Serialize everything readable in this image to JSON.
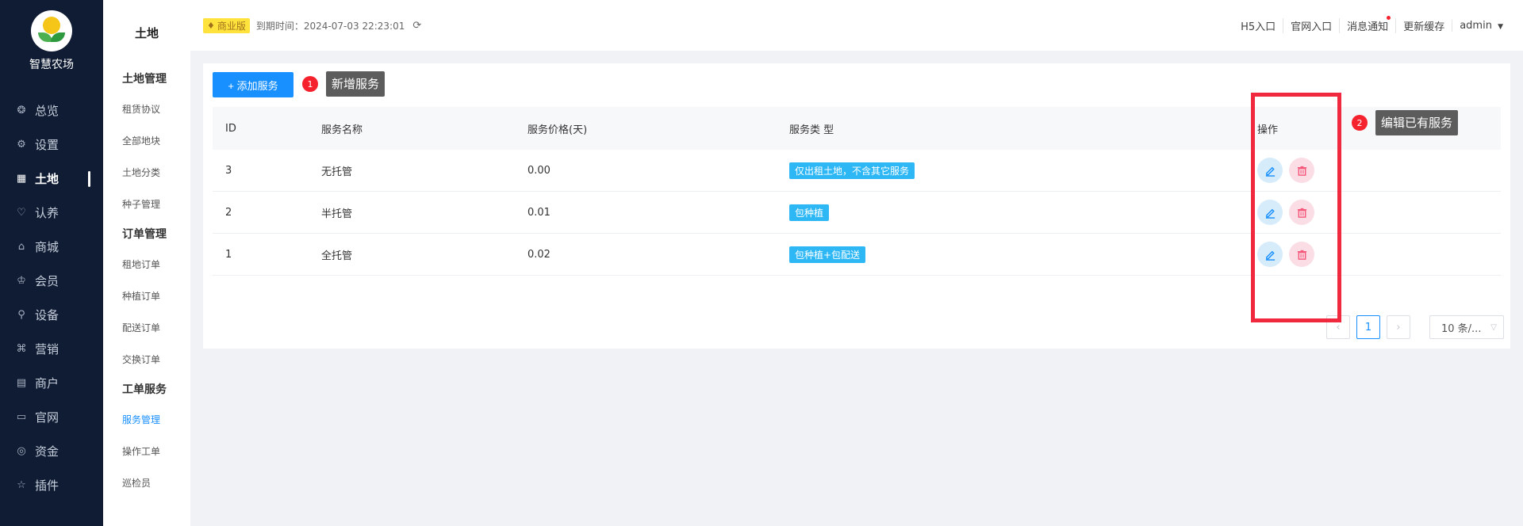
{
  "app": {
    "logo_text": "智慧农场"
  },
  "sidebar": {
    "items": [
      {
        "label": "总览",
        "icon": "dashboard-icon",
        "glyph": "❂"
      },
      {
        "label": "设置",
        "icon": "gear-icon",
        "glyph": "⚙"
      },
      {
        "label": "土地",
        "icon": "grid-icon",
        "glyph": "▦",
        "active": true
      },
      {
        "label": "认养",
        "icon": "heart-icon",
        "glyph": "♡"
      },
      {
        "label": "商城",
        "icon": "store-icon",
        "glyph": "⌂"
      },
      {
        "label": "会员",
        "icon": "crown-icon",
        "glyph": "♔"
      },
      {
        "label": "设备",
        "icon": "bulb-icon",
        "glyph": "⚲"
      },
      {
        "label": "营销",
        "icon": "command-icon",
        "glyph": "⌘"
      },
      {
        "label": "商户",
        "icon": "shop-icon",
        "glyph": "▤"
      },
      {
        "label": "官网",
        "icon": "window-icon",
        "glyph": "▭"
      },
      {
        "label": "资金",
        "icon": "coin-icon",
        "glyph": "◎"
      },
      {
        "label": "插件",
        "icon": "star-icon",
        "glyph": "☆"
      }
    ]
  },
  "subnav": {
    "title": "土地",
    "groups": [
      {
        "title": "土地管理",
        "items": [
          "租赁协议",
          "全部地块",
          "土地分类",
          "种子管理"
        ]
      },
      {
        "title": "订单管理",
        "items": [
          "租地订单",
          "种植订单",
          "配送订单",
          "交换订单"
        ]
      },
      {
        "title": "工单服务",
        "items": [
          "服务管理",
          "操作工单",
          "巡检员"
        ]
      }
    ],
    "active": "服务管理"
  },
  "header": {
    "edition": "商业版",
    "expire": "到期时间：2024-07-03 22:23:01",
    "links": [
      "H5入口",
      "官网入口",
      "消息通知",
      "更新缓存",
      "admin"
    ]
  },
  "toolbar": {
    "add_label": "+ 添加服务"
  },
  "table": {
    "columns": [
      "ID",
      "服务名称",
      "服务价格(天)",
      "服务类 型",
      "操作"
    ],
    "rows": [
      {
        "id": "3",
        "name": "无托管",
        "price": "0.00",
        "type": "仅出租土地，不含其它服务"
      },
      {
        "id": "2",
        "name": "半托管",
        "price": "0.01",
        "type": "包种植"
      },
      {
        "id": "1",
        "name": "全托管",
        "price": "0.02",
        "type": "包种植+包配送"
      }
    ]
  },
  "pagination": {
    "current": "1",
    "page_size": "10 条/..."
  },
  "annotations": [
    {
      "num": "1",
      "text": "新增服务"
    },
    {
      "num": "2",
      "text": "编辑已有服务"
    }
  ],
  "colors": {
    "primary": "#1890ff",
    "sidebar_bg": "#0f1c33",
    "tag": "#2db7f5",
    "annotation_red": "#f0293e"
  }
}
